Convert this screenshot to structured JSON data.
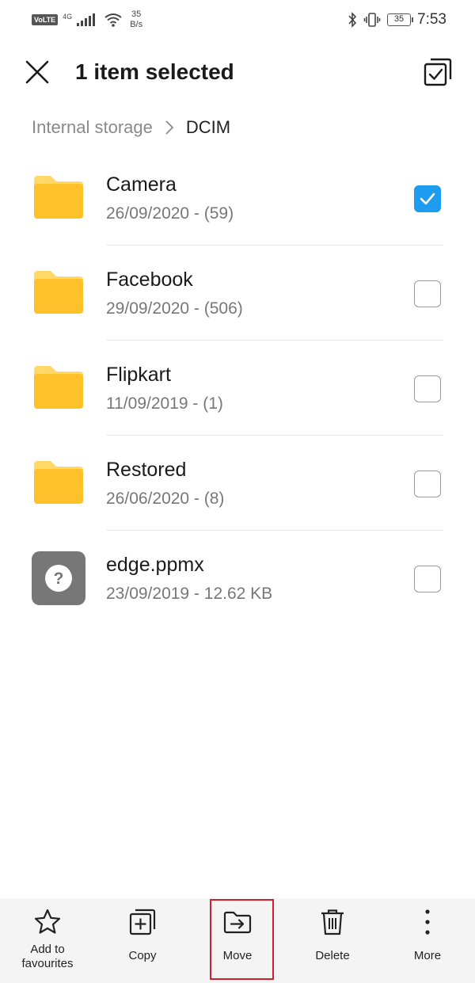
{
  "status_bar": {
    "volte": "VoLTE",
    "network": "4G",
    "speed_value": "35",
    "speed_unit": "B/s",
    "battery": "35",
    "time": "7:53"
  },
  "header": {
    "title": "1 item selected"
  },
  "breadcrumb": {
    "root": "Internal storage",
    "current": "DCIM"
  },
  "files": [
    {
      "name": "Camera",
      "meta": "26/09/2020 - (59)",
      "type": "folder",
      "selected": true
    },
    {
      "name": "Facebook",
      "meta": "29/09/2020 - (506)",
      "type": "folder",
      "selected": false
    },
    {
      "name": "Flipkart",
      "meta": "11/09/2019 - (1)",
      "type": "folder",
      "selected": false
    },
    {
      "name": "Restored",
      "meta": "26/06/2020 - (8)",
      "type": "folder",
      "selected": false
    },
    {
      "name": "edge.ppmx",
      "meta": "23/09/2019 - 12.62 KB",
      "type": "unknown-file",
      "selected": false
    }
  ],
  "actions": {
    "favourites_line1": "Add to",
    "favourites_line2": "favourites",
    "copy": "Copy",
    "move": "Move",
    "delete": "Delete",
    "more": "More"
  },
  "colors": {
    "folder": "#FFC12A",
    "folder_tab": "#FFD86A",
    "check_selected": "#1E9CF0",
    "highlight": "#D0202A"
  }
}
